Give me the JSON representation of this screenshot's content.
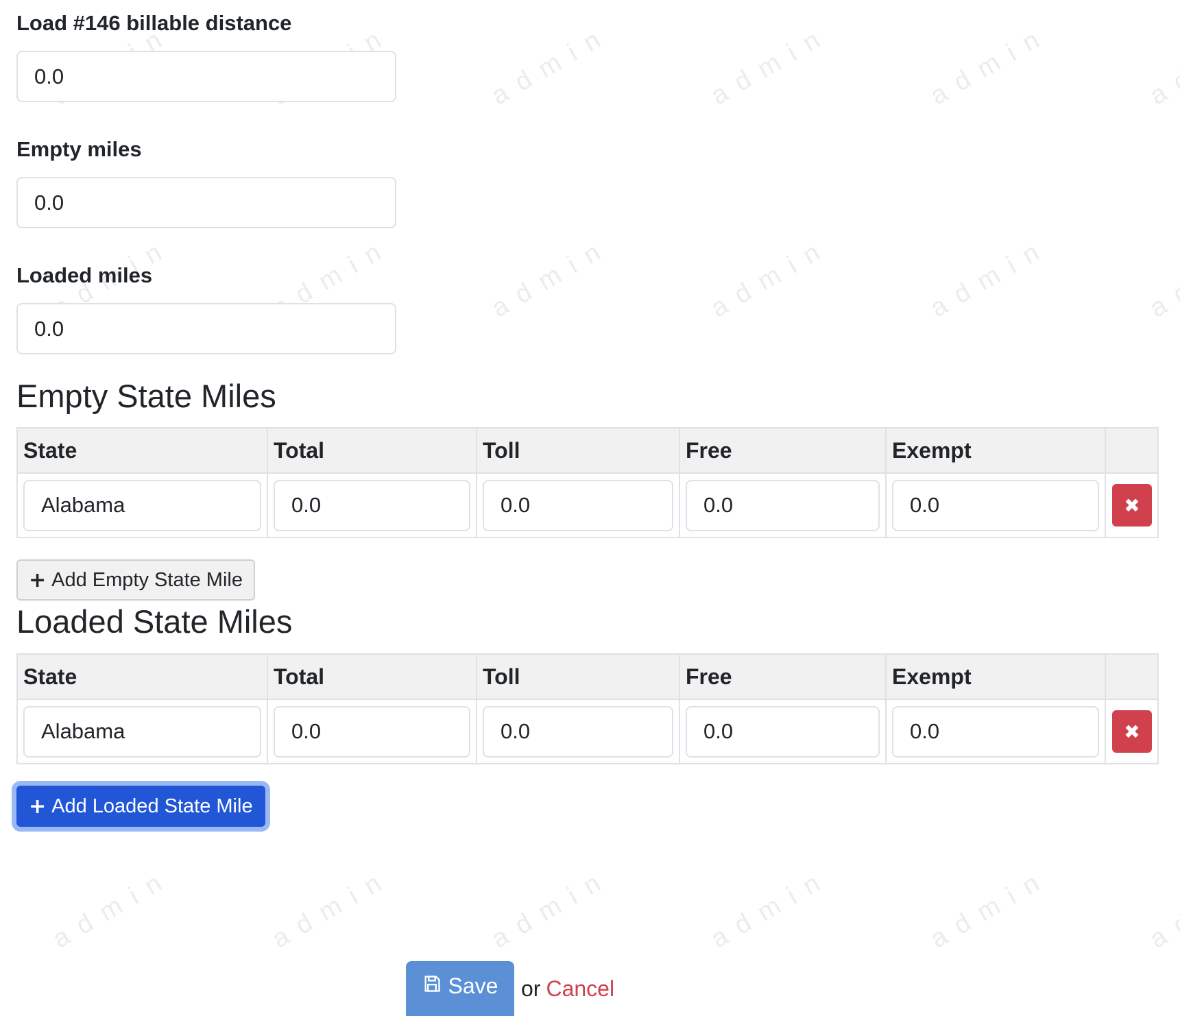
{
  "watermark_text": "admin",
  "fields": {
    "billable_label": "Load #146 billable distance",
    "billable_value": "0.0",
    "empty_miles_label": "Empty miles",
    "empty_miles_value": "0.0",
    "loaded_miles_label": "Loaded miles",
    "loaded_miles_value": "0.0"
  },
  "empty_state_miles": {
    "title": "Empty State Miles",
    "columns": [
      "State",
      "Total",
      "Toll",
      "Free",
      "Exempt"
    ],
    "rows": [
      {
        "state": "Alabama",
        "total": "0.0",
        "toll": "0.0",
        "free": "0.0",
        "exempt": "0.0"
      }
    ],
    "add_label": "Add Empty State Mile"
  },
  "loaded_state_miles": {
    "title": "Loaded State Miles",
    "columns": [
      "State",
      "Total",
      "Toll",
      "Free",
      "Exempt"
    ],
    "rows": [
      {
        "state": "Alabama",
        "total": "0.0",
        "toll": "0.0",
        "free": "0.0",
        "exempt": "0.0"
      }
    ],
    "add_label": "Add Loaded State Mile"
  },
  "actions": {
    "save_label": "Save",
    "or_text": "or",
    "cancel_label": "Cancel"
  },
  "icons": {
    "add": "plus-icon",
    "delete": "times-icon",
    "save": "floppy-disk-icon"
  },
  "colors": {
    "primary": "#2157d6",
    "danger": "#d0414d",
    "save": "#5b8fd6",
    "table_header_bg": "#f1f1f1"
  }
}
